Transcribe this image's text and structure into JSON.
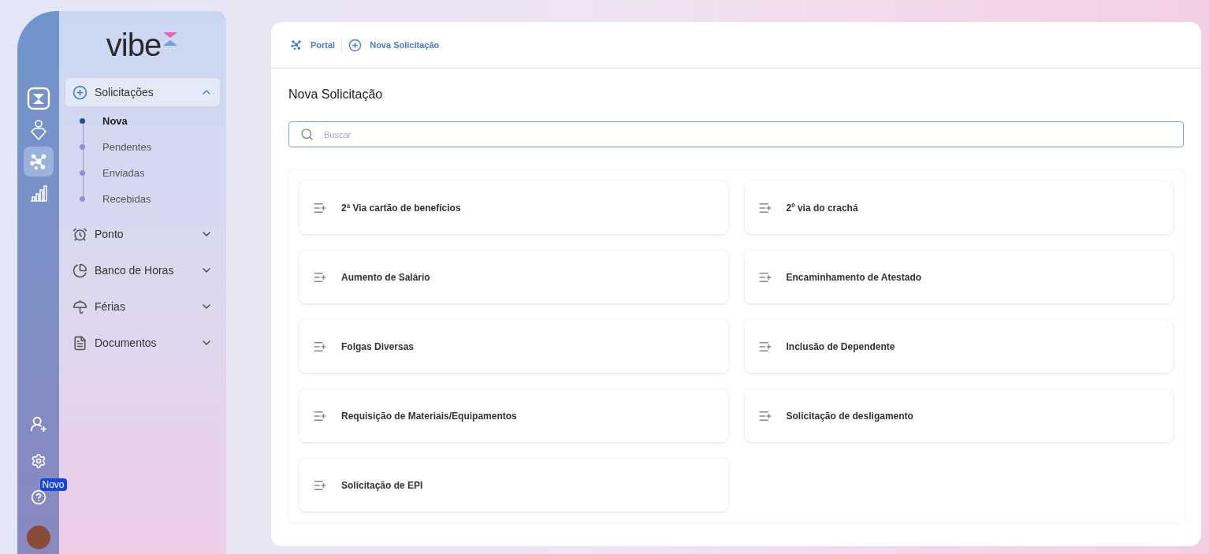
{
  "logo": {
    "text": "vibe"
  },
  "rail": {
    "top": [
      {
        "kind": "hourglass",
        "selected": false
      },
      {
        "kind": "person-ai",
        "selected": false
      },
      {
        "kind": "network",
        "selected": true
      },
      {
        "kind": "chart",
        "selected": false
      }
    ],
    "bottom": [
      {
        "kind": "add-user"
      },
      {
        "kind": "settings"
      },
      {
        "kind": "help",
        "badge": "Novo"
      },
      {
        "kind": "avatar"
      }
    ]
  },
  "sidebar": {
    "items": [
      {
        "label": "Solicitações",
        "kind": "plus",
        "expanded": true,
        "children": [
          {
            "label": "Nova",
            "selected": true
          },
          {
            "label": "Pendentes",
            "selected": false
          },
          {
            "label": "Enviadas",
            "selected": false
          },
          {
            "label": "Recebidas",
            "selected": false
          }
        ]
      },
      {
        "label": "Ponto",
        "kind": "alarm",
        "expanded": false
      },
      {
        "label": "Banco de Horas",
        "kind": "pie",
        "expanded": false
      },
      {
        "label": "Férias",
        "kind": "umbrella",
        "expanded": false
      },
      {
        "label": "Documentos",
        "kind": "document",
        "expanded": false
      }
    ]
  },
  "breadcrumb": [
    {
      "label": "Portal",
      "kind": "network"
    },
    {
      "label": "Nova Solicitação",
      "kind": "plus"
    }
  ],
  "page_title": "Nova Solicitação",
  "search": {
    "placeholder": "Buscar"
  },
  "requests": [
    {
      "label": "2ª Via cartão de benefícios"
    },
    {
      "label": "2º via do crachá"
    },
    {
      "label": "Aumento de Salário"
    },
    {
      "label": "Encaminhamento de Atestado"
    },
    {
      "label": "Folgas Diversas"
    },
    {
      "label": "Inclusão de Dependente"
    },
    {
      "label": "Requisição de Materiais/Equipamentos"
    },
    {
      "label": "Solicitação de desligamento"
    },
    {
      "label": "Solicitação de EPI"
    }
  ]
}
